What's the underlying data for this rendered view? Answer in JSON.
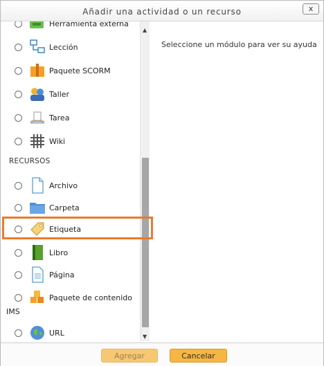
{
  "dialog": {
    "title": "Añadir una actividad o un recurso",
    "close_label": "x"
  },
  "activities": [
    {
      "label": "Herramienta externa",
      "icon": "external-tool-icon"
    },
    {
      "label": "Lección",
      "icon": "lesson-icon"
    },
    {
      "label": "Paquete SCORM",
      "icon": "scorm-package-icon"
    },
    {
      "label": "Taller",
      "icon": "workshop-icon"
    },
    {
      "label": "Tarea",
      "icon": "assignment-icon"
    },
    {
      "label": "Wiki",
      "icon": "wiki-icon"
    }
  ],
  "resources_heading": "RECURSOS",
  "resources": [
    {
      "label": "Archivo",
      "icon": "file-icon"
    },
    {
      "label": "Carpeta",
      "icon": "folder-icon"
    },
    {
      "label": "Etiqueta",
      "icon": "label-tag-icon"
    },
    {
      "label": "Libro",
      "icon": "book-icon"
    },
    {
      "label": "Página",
      "icon": "page-icon"
    },
    {
      "label": "Paquete de contenido",
      "label_cont": "IMS",
      "icon": "ims-package-icon"
    },
    {
      "label": "URL",
      "icon": "url-icon"
    }
  ],
  "help_text": "Seleccione un módulo para ver su ayuda",
  "buttons": {
    "add": "Agregar",
    "cancel": "Cancelar"
  },
  "colors": {
    "highlight": "#ea7a2d",
    "button_primary": "#f5b643",
    "button_disabled": "#f7c873"
  }
}
